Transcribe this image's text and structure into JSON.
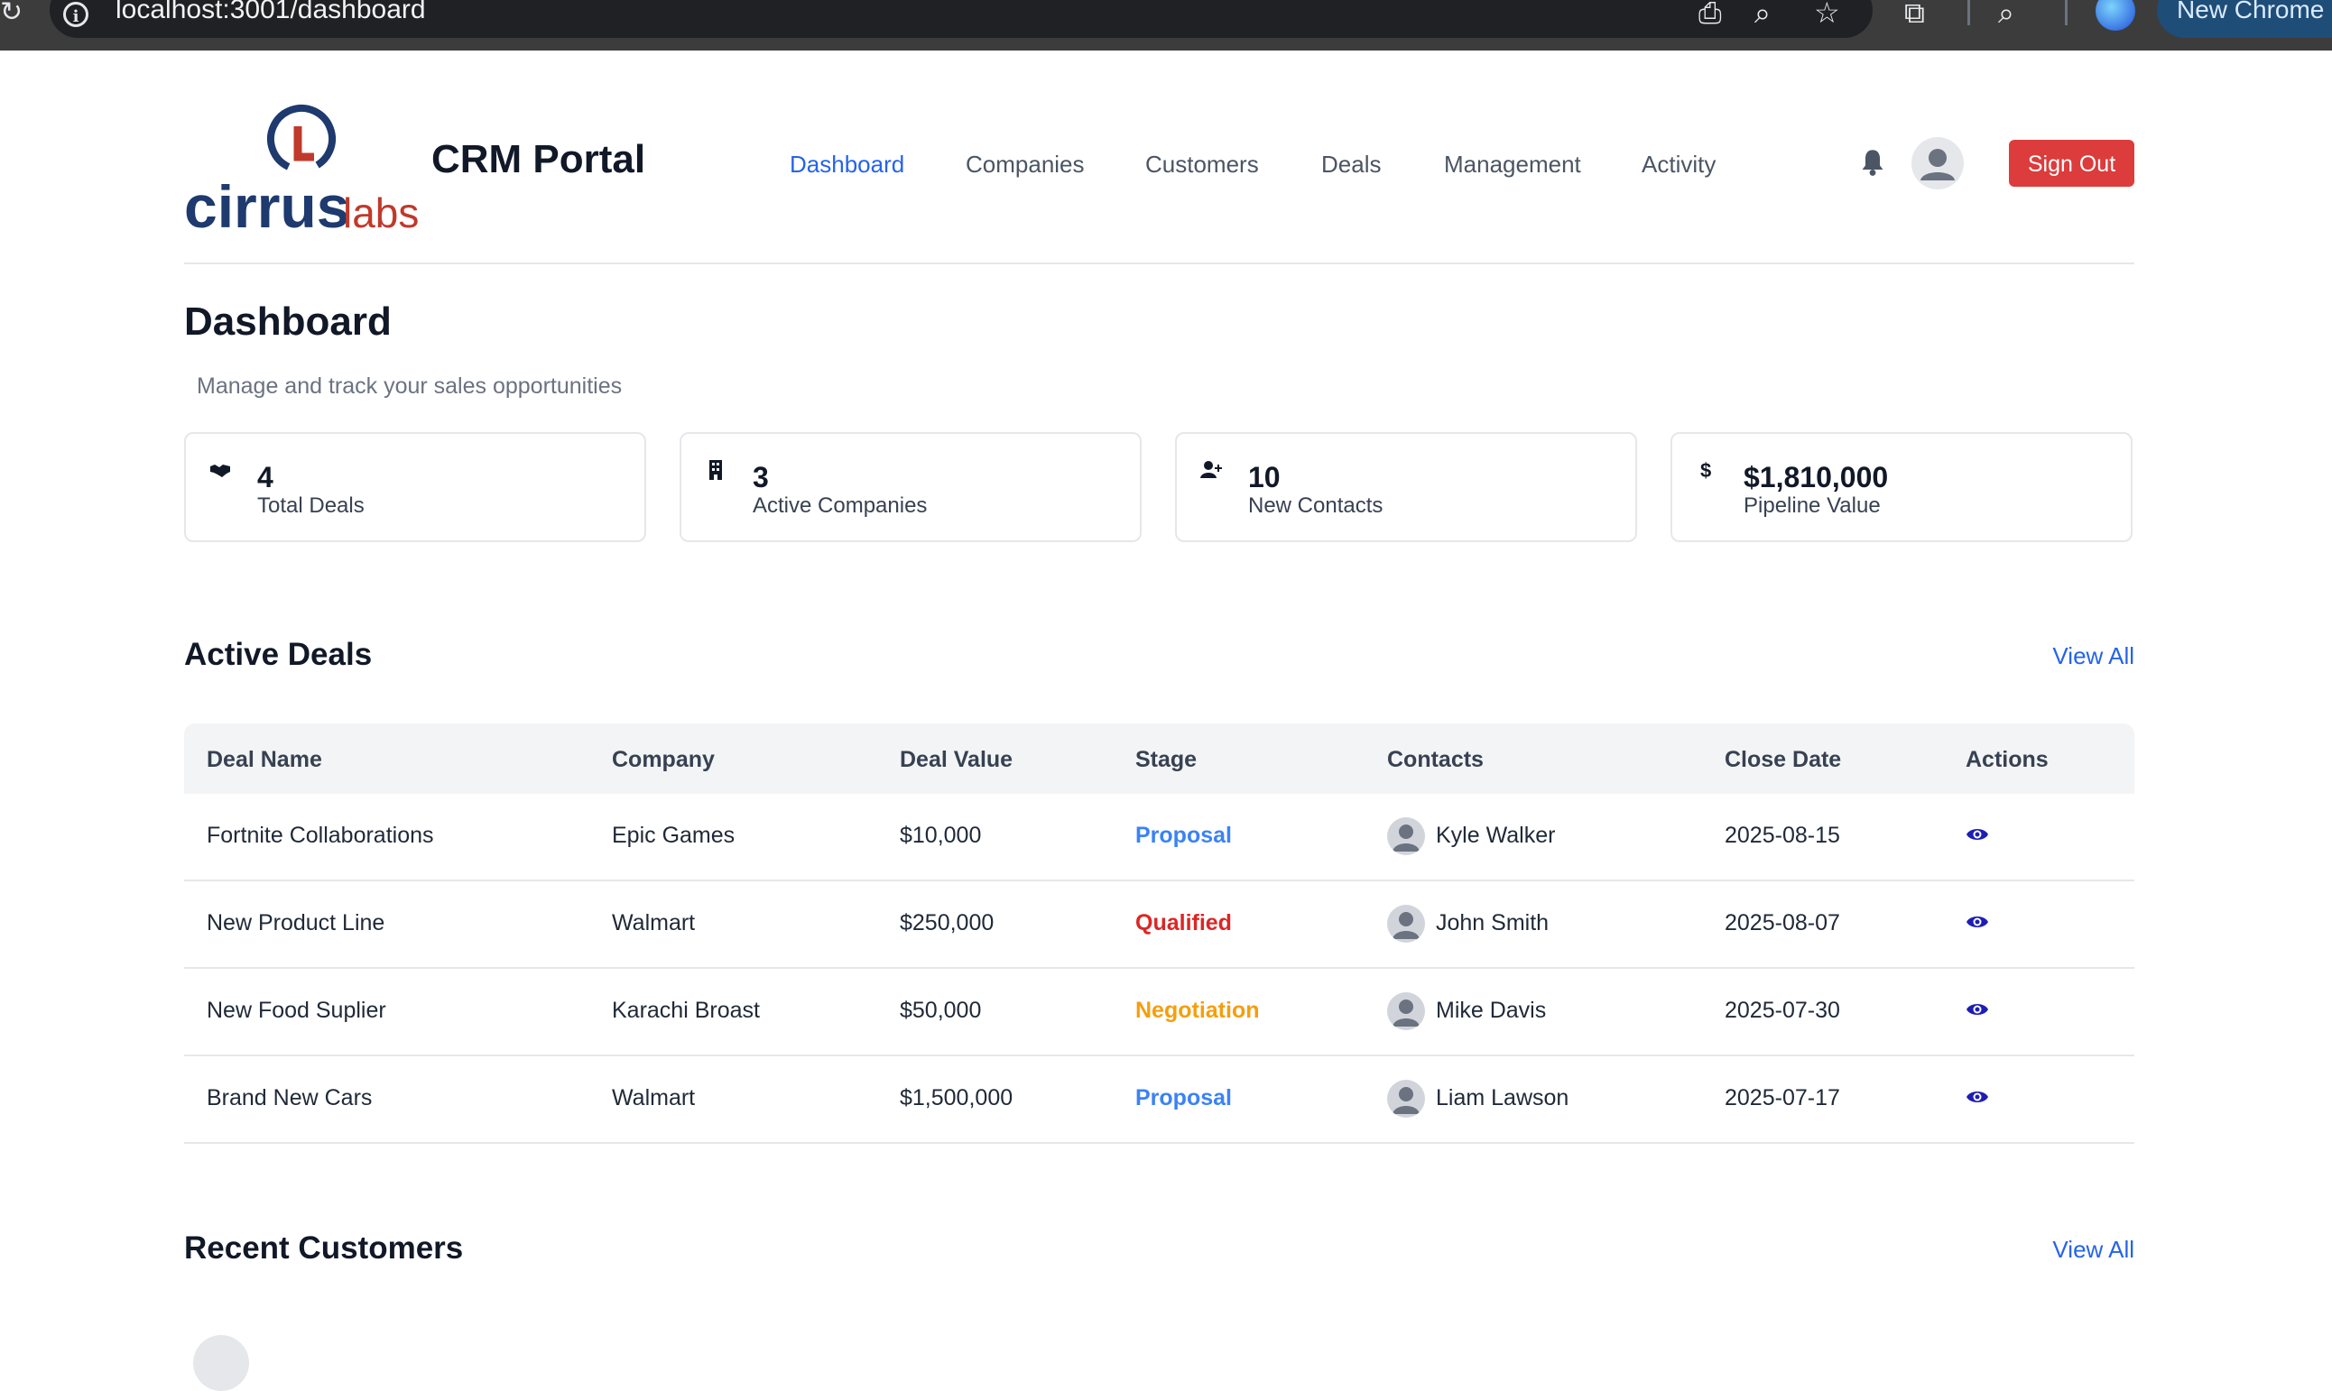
{
  "browser": {
    "url": "localhost:3001/dashboard",
    "new_chrome_label": "New Chrome"
  },
  "header": {
    "logo_text_main": "cirrus",
    "logo_text_sub": "labs",
    "app_title": "CRM Portal",
    "nav": [
      {
        "label": "Dashboard",
        "active": true
      },
      {
        "label": "Companies",
        "active": false
      },
      {
        "label": "Customers",
        "active": false
      },
      {
        "label": "Deals",
        "active": false
      },
      {
        "label": "Management",
        "active": false
      },
      {
        "label": "Activity",
        "active": false
      }
    ],
    "sign_out_label": "Sign Out"
  },
  "page": {
    "title": "Dashboard",
    "subtitle": "Manage and track your sales opportunities"
  },
  "stats": [
    {
      "icon": "handshake-icon",
      "value": "4",
      "label": "Total Deals"
    },
    {
      "icon": "building-icon",
      "value": "3",
      "label": "Active Companies"
    },
    {
      "icon": "user-plus-icon",
      "value": "10",
      "label": "New Contacts"
    },
    {
      "icon": "dollar-icon",
      "value": "$1,810,000",
      "label": "Pipeline Value"
    }
  ],
  "active_deals": {
    "title": "Active Deals",
    "view_all_label": "View All",
    "columns": [
      "Deal Name",
      "Company",
      "Deal Value",
      "Stage",
      "Contacts",
      "Close Date",
      "Actions"
    ],
    "rows": [
      {
        "deal_name": "Fortnite Collaborations",
        "company": "Epic Games",
        "value": "$10,000",
        "stage": "Proposal",
        "contact": "Kyle Walker",
        "close_date": "2025-08-15"
      },
      {
        "deal_name": "New Product Line",
        "company": "Walmart",
        "value": "$250,000",
        "stage": "Qualified",
        "contact": "John Smith",
        "close_date": "2025-08-07"
      },
      {
        "deal_name": "New Food Suplier",
        "company": "Karachi Broast",
        "value": "$50,000",
        "stage": "Negotiation",
        "contact": "Mike Davis",
        "close_date": "2025-07-30"
      },
      {
        "deal_name": "Brand New Cars",
        "company": "Walmart",
        "value": "$1,500,000",
        "stage": "Proposal",
        "contact": "Liam Lawson",
        "close_date": "2025-07-17"
      }
    ]
  },
  "recent_customers": {
    "title": "Recent Customers",
    "view_all_label": "View All"
  },
  "colors": {
    "accent": "#2563eb",
    "sign_out": "#dc3c3c",
    "stage_proposal": "#3b82f6",
    "stage_qualified": "#dc2626",
    "stage_negotiation": "#f59e0b",
    "eye_icon": "#1e1eb4",
    "logo_navy": "#1e3a6e",
    "logo_red": "#c0392b"
  }
}
